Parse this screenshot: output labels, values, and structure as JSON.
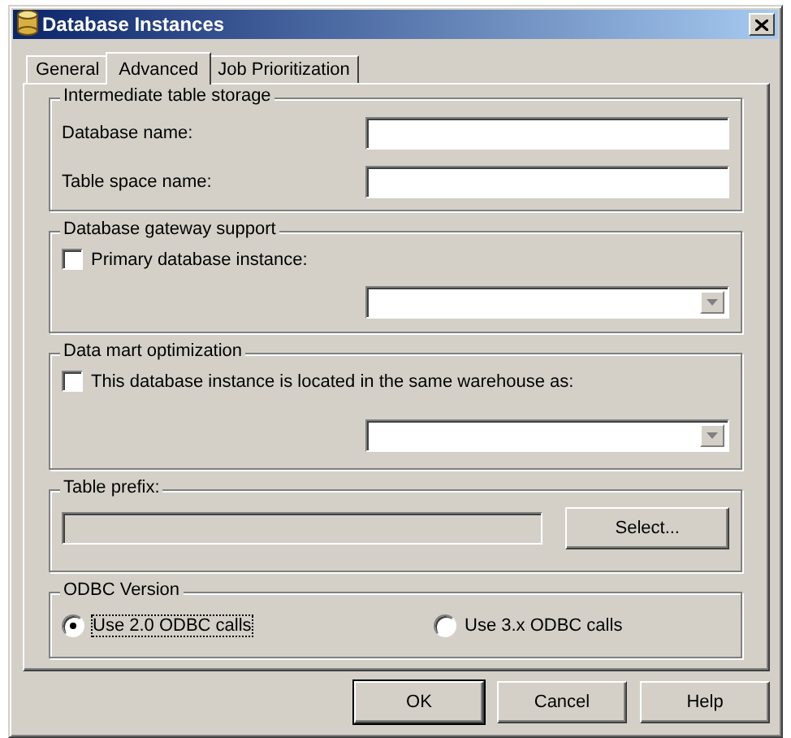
{
  "window": {
    "title": "Database Instances"
  },
  "tabs": [
    {
      "label": "General",
      "selected": false
    },
    {
      "label": "Advanced",
      "selected": true
    },
    {
      "label": "Job Prioritization",
      "selected": false
    }
  ],
  "intermediate_storage": {
    "title": "Intermediate table storage",
    "fields": [
      {
        "label": "Database name:"
      },
      {
        "label": "Table space name:"
      }
    ]
  },
  "gateway_support": {
    "title": "Database gateway support",
    "checkbox": {
      "label": "Primary database instance:",
      "checked": false
    }
  },
  "data_mart": {
    "title": "Data mart optimization",
    "checkbox": {
      "label": "This database instance is located in the same warehouse as:",
      "checked": false
    }
  },
  "table_prefix": {
    "title": "Table prefix:",
    "field": {
      "disabled": true
    },
    "button": "Select..."
  },
  "odbc_version": {
    "title": "ODBC Version",
    "options": [
      {
        "label": "Use 2.0 ODBC calls",
        "selected": true
      },
      {
        "label": "Use 3.x ODBC calls",
        "selected": false
      }
    ]
  },
  "buttons": [
    {
      "label": "OK",
      "default": true
    },
    {
      "label": "Cancel",
      "default": false
    },
    {
      "label": "Help",
      "default": false
    }
  ]
}
